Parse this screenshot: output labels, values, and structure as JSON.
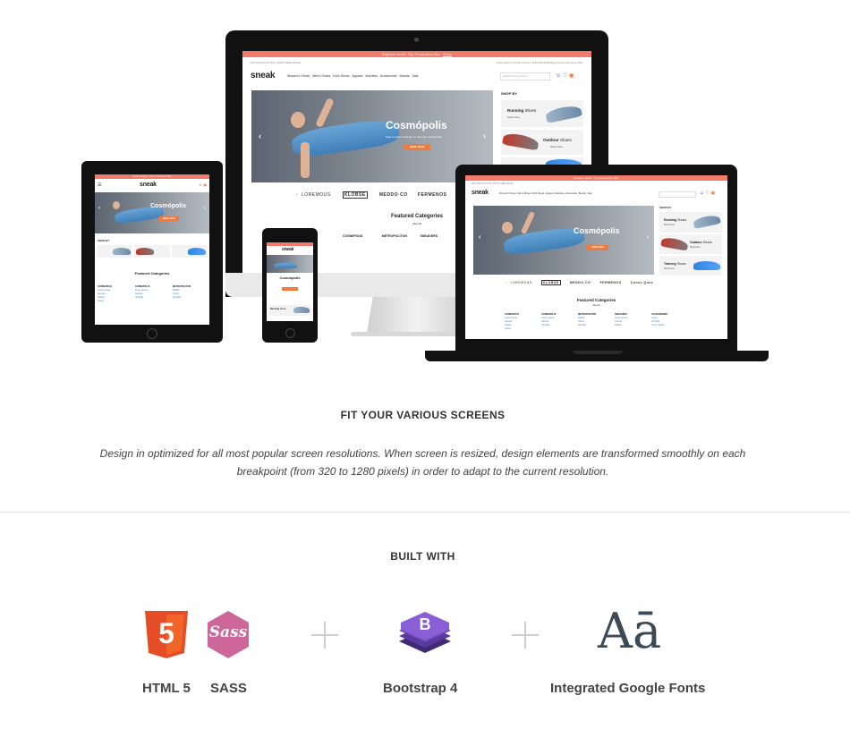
{
  "mockup": {
    "promo_text": "Explore Now!, Top Promotion Bar",
    "promo_link": "Shop",
    "util_left": "USD DISCOUNT 5%, SHOP FREE PRICE",
    "util_right": "Need Help? or Order Online 1-800-000-0000   Blog   Promo Help   Eng   USD",
    "logo": "sneak",
    "search_placeholder": "Search for a product...",
    "nav_items": [
      "Women's Shoes",
      "Men's Shoes",
      "Kid's Shoes",
      "Apparel",
      "Activities",
      "Accessories",
      "Brands",
      "Sale"
    ],
    "hero_title": "Cosmópolis",
    "hero_subtitle": "Save a brand: workout on all smart accessories",
    "hero_cta": "SHOP NOW",
    "shop_by": "SHOP BY",
    "side_cards": [
      {
        "title": "Running",
        "suffix": "Shoes",
        "link": "Shop Now"
      },
      {
        "title": "Outdoor",
        "suffix": "Shoes",
        "link": "Shop Now"
      },
      {
        "title": "Training",
        "suffix": "Shoes",
        "link": "Shop Now"
      }
    ],
    "brands": [
      "LOREMOUS",
      "KLOBSE",
      "MEDDO·CO",
      "FERMENOS",
      "Conse Ques"
    ],
    "featured_title": "Featured Categories",
    "featured_sub": "See All",
    "category_heads": [
      "COSNEPOUS",
      "COSNEPOLIS",
      "METROPOLITON",
      "SNEAKERS",
      "ACCESSORIES"
    ],
    "category_links": [
      "Lorem ipsum",
      "Caesra",
      "Nullam",
      "Cesar",
      "Viva Elit",
      "View..."
    ],
    "phone_title": "Cosmopolis"
  },
  "screens_section": {
    "title": "FIT YOUR VARIOUS SCREENS",
    "description": "Design in optimized for all most popular screen resolutions. When screen is resized, design elements are transformed smoothly on each breakpoint (from 320 to 1280 pixels) in order to adapt to the current resolution."
  },
  "built_section": {
    "title": "BUILT WITH",
    "html5_label": "HTML 5",
    "sass_label": "SASS",
    "sass_logo_text": "Sass",
    "html5_logo_text": "5",
    "bootstrap_label": "Bootstrap 4",
    "bootstrap_logo_text": "B",
    "fonts_label": "Integrated Google Fonts",
    "fonts_logo_text": "Aā"
  },
  "colors": {
    "accent": "#f27b6c",
    "html5": "#e44d26",
    "sass": "#cd6799",
    "bootstrap": "#7952b3",
    "fonts_logo": "#3c4a55"
  }
}
